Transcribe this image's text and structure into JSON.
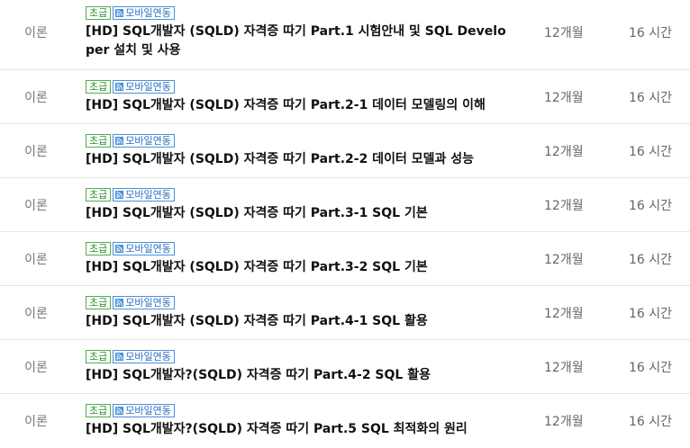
{
  "courses": [
    {
      "category": "이론",
      "level": "초급",
      "mobile": "모바일연동",
      "title": "[HD] SQL개발자 (SQLD) 자격증 따기 Part.1 시험안내 및 SQL Developer 설치 및 사용",
      "period": "12개월",
      "hours": "16 시간"
    },
    {
      "category": "이론",
      "level": "초급",
      "mobile": "모바일연동",
      "title": "[HD] SQL개발자 (SQLD) 자격증 따기 Part.2-1 데이터 모델링의 이해",
      "period": "12개월",
      "hours": "16 시간"
    },
    {
      "category": "이론",
      "level": "초급",
      "mobile": "모바일연동",
      "title": "[HD] SQL개발자 (SQLD) 자격증 따기 Part.2-2 데이터 모델과 성능",
      "period": "12개월",
      "hours": "16 시간"
    },
    {
      "category": "이론",
      "level": "초급",
      "mobile": "모바일연동",
      "title": "[HD] SQL개발자 (SQLD) 자격증 따기 Part.3-1 SQL 기본",
      "period": "12개월",
      "hours": "16 시간"
    },
    {
      "category": "이론",
      "level": "초급",
      "mobile": "모바일연동",
      "title": "[HD] SQL개발자 (SQLD) 자격증 따기 Part.3-2 SQL 기본",
      "period": "12개월",
      "hours": "16 시간"
    },
    {
      "category": "이론",
      "level": "초급",
      "mobile": "모바일연동",
      "title": "[HD] SQL개발자 (SQLD) 자격증 따기 Part.4-1 SQL 활용",
      "period": "12개월",
      "hours": "16 시간"
    },
    {
      "category": "이론",
      "level": "초급",
      "mobile": "모바일연동",
      "title": "[HD] SQL개발자?(SQLD) 자격증 따기 Part.4-2 SQL 활용",
      "period": "12개월",
      "hours": "16 시간"
    },
    {
      "category": "이론",
      "level": "초급",
      "mobile": "모바일연동",
      "title": "[HD] SQL개발자?(SQLD) 자격증 따기 Part.5 SQL 최적화의 원리",
      "period": "12개월",
      "hours": "16 시간"
    }
  ],
  "icons": {
    "mobile_badge_icon": "rss-icon"
  },
  "colors": {
    "level_badge": "#4caf50",
    "mobile_badge": "#4a90d9",
    "divider": "#e6e6e6"
  }
}
